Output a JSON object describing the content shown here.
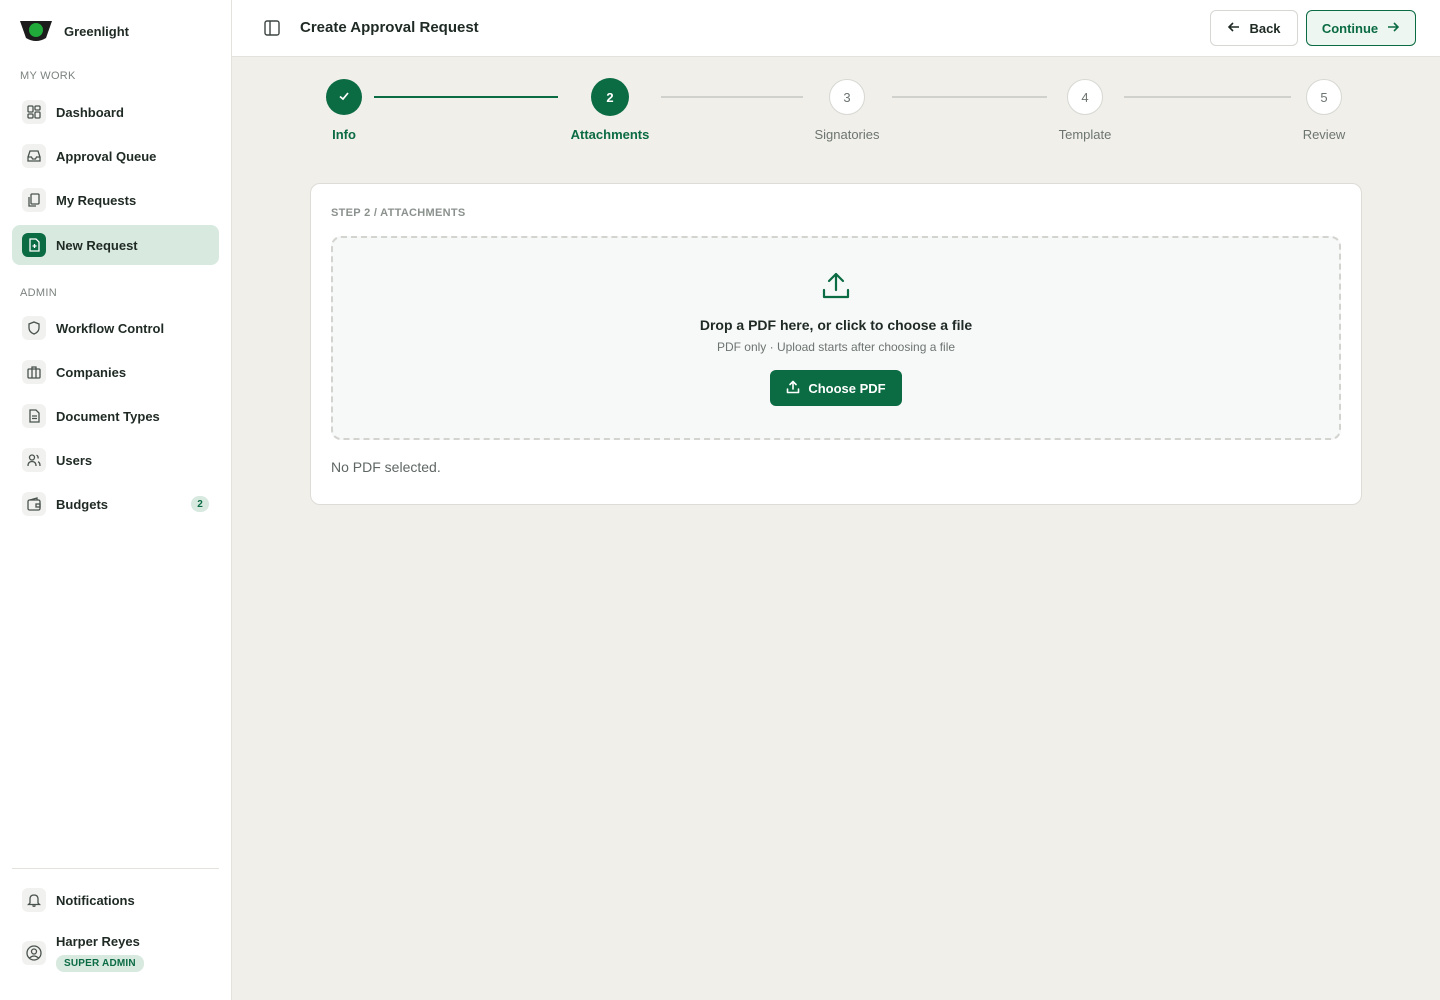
{
  "brand": {
    "name": "Greenlight"
  },
  "sidebar": {
    "sections": [
      {
        "label": "MY WORK"
      },
      {
        "label": "ADMIN"
      }
    ],
    "items": [
      {
        "label": "Dashboard",
        "icon": "dashboard-icon"
      },
      {
        "label": "Approval Queue",
        "icon": "inbox-icon"
      },
      {
        "label": "My Requests",
        "icon": "documents-icon"
      },
      {
        "label": "New Request",
        "icon": "file-plus-icon",
        "active": true
      },
      {
        "label": "Workflow Control",
        "icon": "shield-icon"
      },
      {
        "label": "Companies",
        "icon": "briefcase-icon"
      },
      {
        "label": "Document Types",
        "icon": "file-text-icon"
      },
      {
        "label": "Users",
        "icon": "users-icon"
      },
      {
        "label": "Budgets",
        "icon": "wallet-icon",
        "badge": "2"
      }
    ],
    "notifications": {
      "label": "Notifications",
      "icon": "bell-icon"
    },
    "user": {
      "name": "Harper Reyes",
      "role": "SUPER ADMIN"
    }
  },
  "header": {
    "title": "Create Approval Request",
    "back_label": "Back",
    "continue_label": "Continue"
  },
  "stepper": {
    "steps": [
      {
        "number": "",
        "label": "Info",
        "state": "done"
      },
      {
        "number": "2",
        "label": "Attachments",
        "state": "current"
      },
      {
        "number": "3",
        "label": "Signatories",
        "state": "todo"
      },
      {
        "number": "4",
        "label": "Template",
        "state": "todo"
      },
      {
        "number": "5",
        "label": "Review",
        "state": "todo"
      }
    ]
  },
  "card": {
    "eyebrow": "STEP 2 / ATTACHMENTS",
    "dropzone": {
      "title": "Drop a PDF here, or click to choose a file",
      "subtitle": "PDF only · Upload starts after choosing a file",
      "button_label": "Choose PDF"
    },
    "status": "No PDF selected."
  },
  "colors": {
    "accent": "#0b6b43",
    "accent_soft": "#d8e9e0",
    "background": "#f0efea"
  }
}
